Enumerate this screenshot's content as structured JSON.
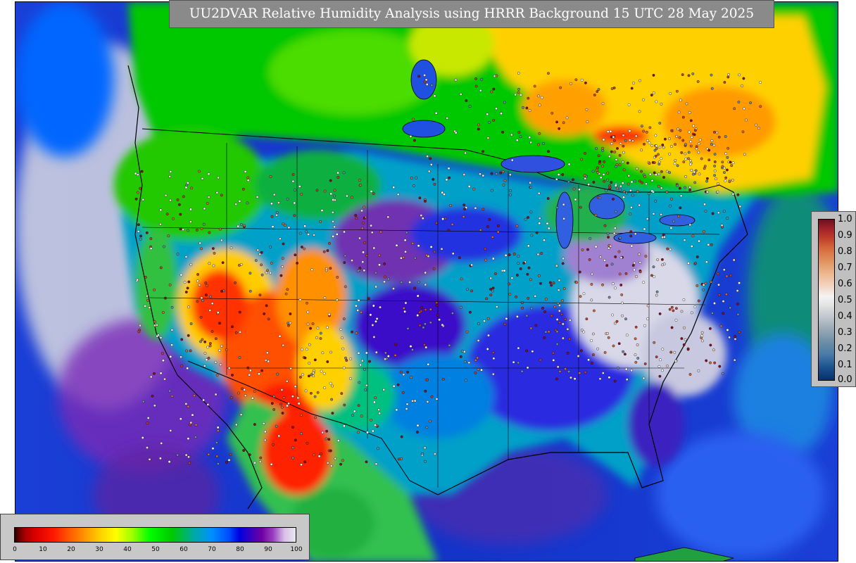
{
  "title": "UU2DVAR Relative Humidity Analysis using HRRR Background 15 UTC 28 May 2025",
  "ob_legend": {
    "ticks": [
      "1.0",
      "0.9",
      "0.8",
      "0.7",
      "0.6",
      "0.5",
      "0.4",
      "0.3",
      "0.2",
      "0.1",
      "0.0"
    ]
  },
  "rh_legend": {
    "ticks": [
      "0",
      "10",
      "20",
      "30",
      "40",
      "50",
      "60",
      "70",
      "80",
      "90",
      "100"
    ]
  },
  "colors": {
    "ocean": "#1a3fd6",
    "land_mid": "#00c8c8",
    "dry_red": "#ff1a00",
    "moist_purple": "#7000a0",
    "canada_yellow": "#ffcc00"
  }
}
